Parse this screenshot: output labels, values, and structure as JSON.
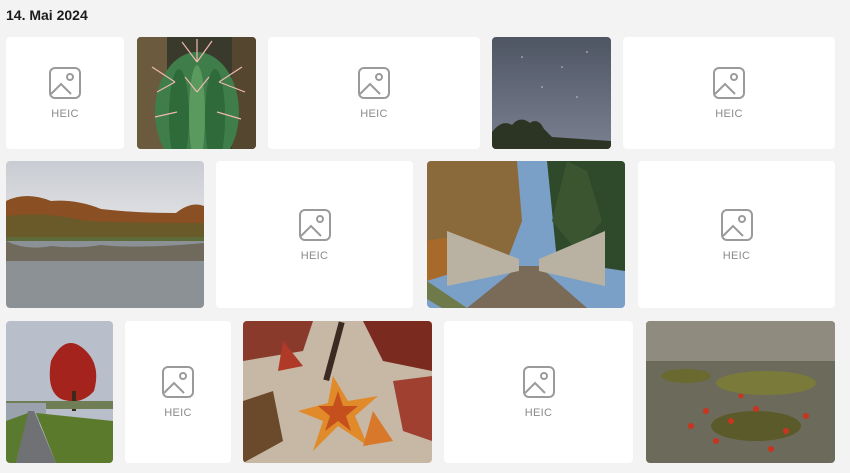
{
  "gallery": {
    "date_header": "14. Mai 2024",
    "placeholder_label": "HEIC",
    "placeholder_icon": "image-icon",
    "photos": [
      {
        "subject": "cactus"
      },
      {
        "subject": "night-sky"
      },
      {
        "subject": "lake-autumn"
      },
      {
        "subject": "wooden-bridge"
      },
      {
        "subject": "path-red-tree"
      },
      {
        "subject": "autumn-leaves"
      },
      {
        "subject": "leaves-in-water"
      }
    ]
  }
}
